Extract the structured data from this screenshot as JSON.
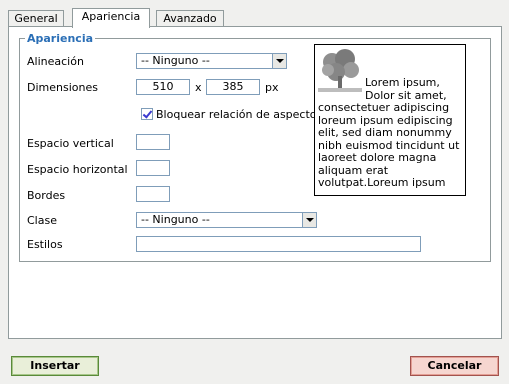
{
  "tabs": [
    {
      "label": "General",
      "active": false
    },
    {
      "label": "Apariencia",
      "active": true
    },
    {
      "label": "Avanzado",
      "active": false
    }
  ],
  "fieldset": {
    "legend": "Apariencia"
  },
  "alineacion": {
    "label": "Alineación",
    "value": "-- Ninguno --"
  },
  "dimensiones": {
    "label": "Dimensiones",
    "width": "510",
    "separator": "x",
    "height": "385",
    "unit": "px"
  },
  "bloquear": {
    "label": "Bloquear relación de aspecto",
    "checked": true
  },
  "espacio_vertical": {
    "label": "Espacio vertical",
    "value": ""
  },
  "espacio_horizontal": {
    "label": "Espacio horizontal",
    "value": ""
  },
  "bordes": {
    "label": "Bordes",
    "value": ""
  },
  "clase": {
    "label": "Clase",
    "value": "-- Ninguno --"
  },
  "estilos": {
    "label": "Estilos",
    "value": ""
  },
  "preview": {
    "text": "Lorem ipsum, Dolor sit amet, consectetuer adipiscing loreum ipsum edipiscing elit, sed diam nonummy nibh euismod tincidunt ut laoreet dolore magna aliquam erat volutpat.Loreum ipsum"
  },
  "buttons": {
    "insert": "Insertar",
    "cancel": "Cancelar"
  },
  "colors": {
    "legend": "#2b6fb6",
    "border": "#919b9c",
    "insert_border": "#5a8a3a",
    "cancel_border": "#a2534e"
  }
}
